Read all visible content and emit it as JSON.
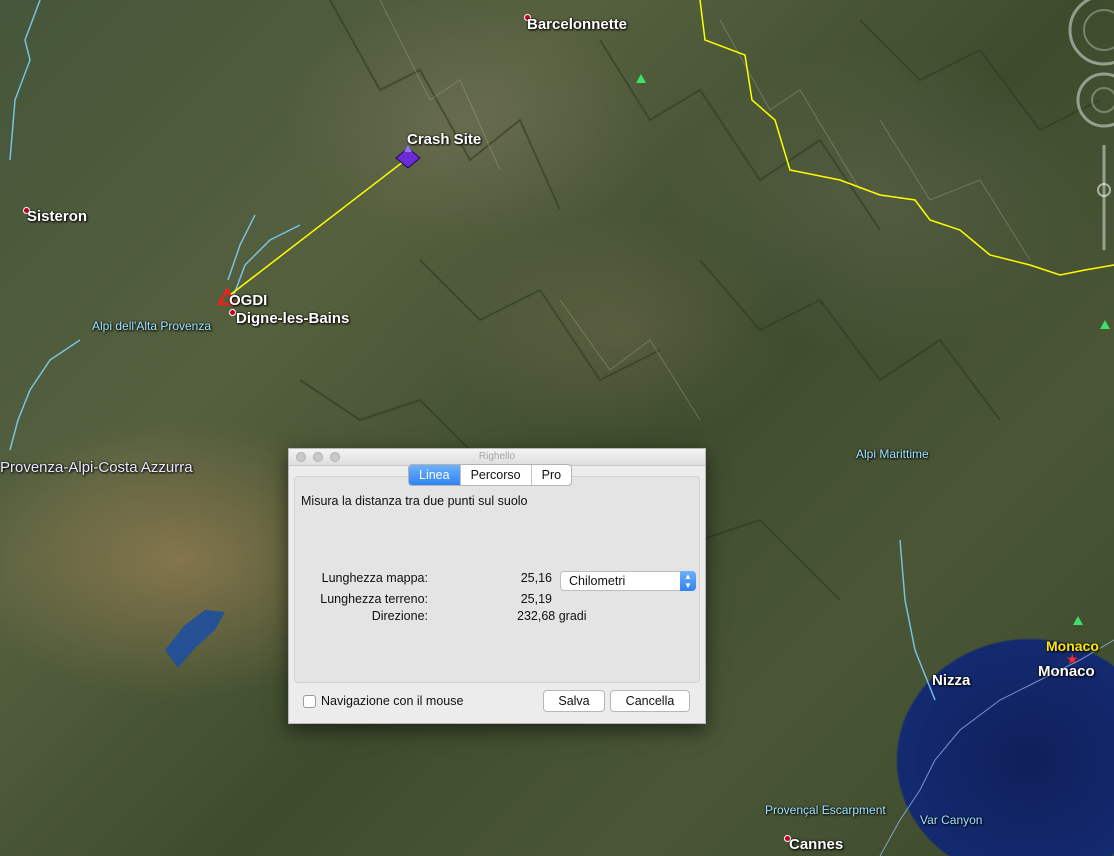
{
  "map": {
    "labels": {
      "barcelonnette": "Barcelonnette",
      "crash_site": "Crash Site",
      "sisteron": "Sisteron",
      "ogdi": "OGDI",
      "digne": "Digne-les-Bains",
      "alpi_alta_provenza": "Alpi dell'Alta Provenza",
      "provenza": "Provenza-Alpi-Costa Azzurra",
      "alpi_marittime": "Alpi Marittime",
      "monaco_yellow": "Monaco",
      "monaco": "Monaco",
      "nizza": "Nizza",
      "provencal_escarpment": "Provençal Escarpment",
      "var_canyon": "Var Canyon",
      "cannes": "Cannes"
    },
    "colors": {
      "ruler_line": "#ffff00",
      "border": "#ffff00",
      "rivers": "#7fd4ff",
      "sea": "#142a70"
    }
  },
  "dialog": {
    "title": "Righello",
    "tabs": [
      {
        "label": "Linea",
        "active": true
      },
      {
        "label": "Percorso",
        "active": false
      },
      {
        "label": "Pro",
        "active": false
      }
    ],
    "description": "Misura la distanza tra due punti sul suolo",
    "map_length_label": "Lunghezza mappa:",
    "map_length_value": "25,16",
    "ground_length_label": "Lunghezza terreno:",
    "ground_length_value": "25,19",
    "heading_label": "Direzione:",
    "heading_value": "232,68 gradi",
    "unit_selected": "Chilometri",
    "mouse_nav_label": "Navigazione con il mouse",
    "mouse_nav_checked": false,
    "save_label": "Salva",
    "cancel_label": "Cancella",
    "accent_color": "#2f83f3"
  }
}
